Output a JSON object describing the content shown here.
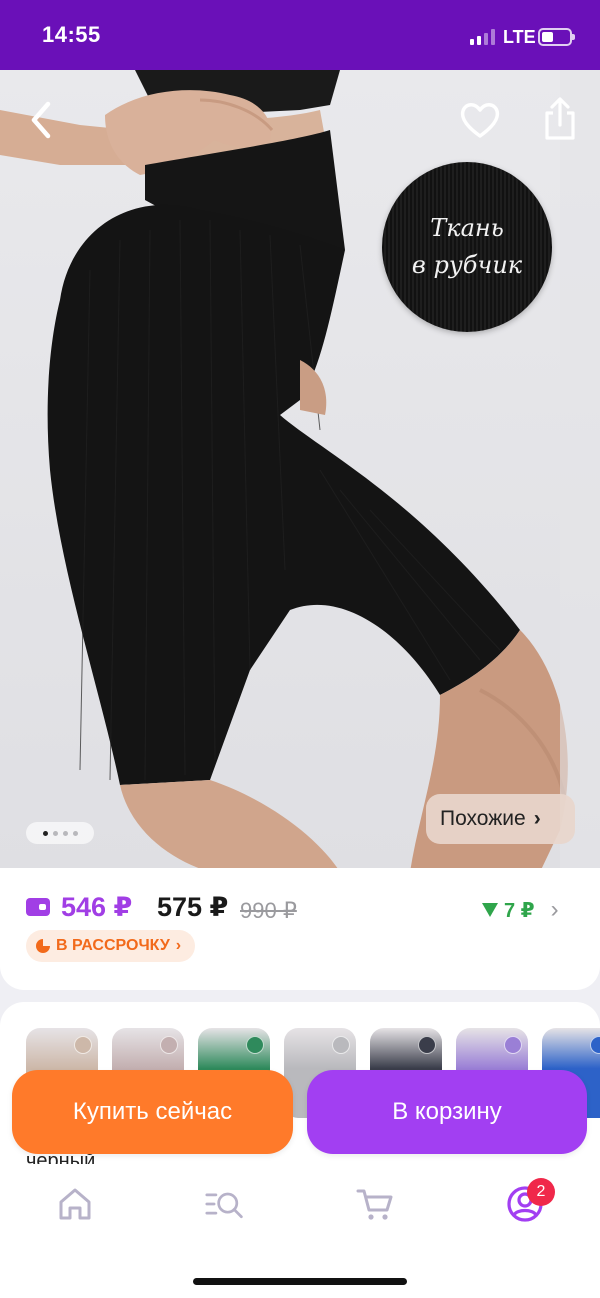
{
  "status_bar": {
    "time": "14:55",
    "network": "LTE",
    "battery_fraction": 0.3
  },
  "header": {
    "back_icon": "chevron-left-icon",
    "favorite_icon": "heart-icon",
    "share_icon": "share-icon"
  },
  "hero": {
    "swatch_text_line1": "Ткань",
    "swatch_text_line2": "в рубчик",
    "gallery_total": 5,
    "gallery_active": 1,
    "similar_label": "Похожие",
    "similar_chevron": "›"
  },
  "price": {
    "wallet_price": "546 ₽",
    "price": "575 ₽",
    "old_price": "990 ₽",
    "cashback": "7 ₽",
    "cashback_icon": "triangle-down-icon",
    "installment_label": "В РАССРОЧКУ",
    "installment_chevron": "›"
  },
  "variants": {
    "thumbnails": [
      {
        "color": "#cdb8a9"
      },
      {
        "color": "#c3afb0"
      },
      {
        "color": "#2f8a5c"
      },
      {
        "color": "#b9b9bd"
      },
      {
        "color": "#3a3d4a"
      },
      {
        "color": "#9a7fd6"
      },
      {
        "color": "#2d62c8"
      }
    ],
    "selected_color_label": "черный"
  },
  "actions": {
    "buy_now": "Купить сейчас",
    "add_to_cart": "В корзину"
  },
  "tabbar": {
    "items": [
      "home-icon",
      "catalog-search-icon",
      "cart-icon",
      "profile-icon"
    ],
    "profile_badge": "2"
  },
  "colors": {
    "brand_purple": "#a23ff2",
    "status_bar": "#6a10b8",
    "orange": "#ff7a2a",
    "green": "#2fa54b"
  }
}
